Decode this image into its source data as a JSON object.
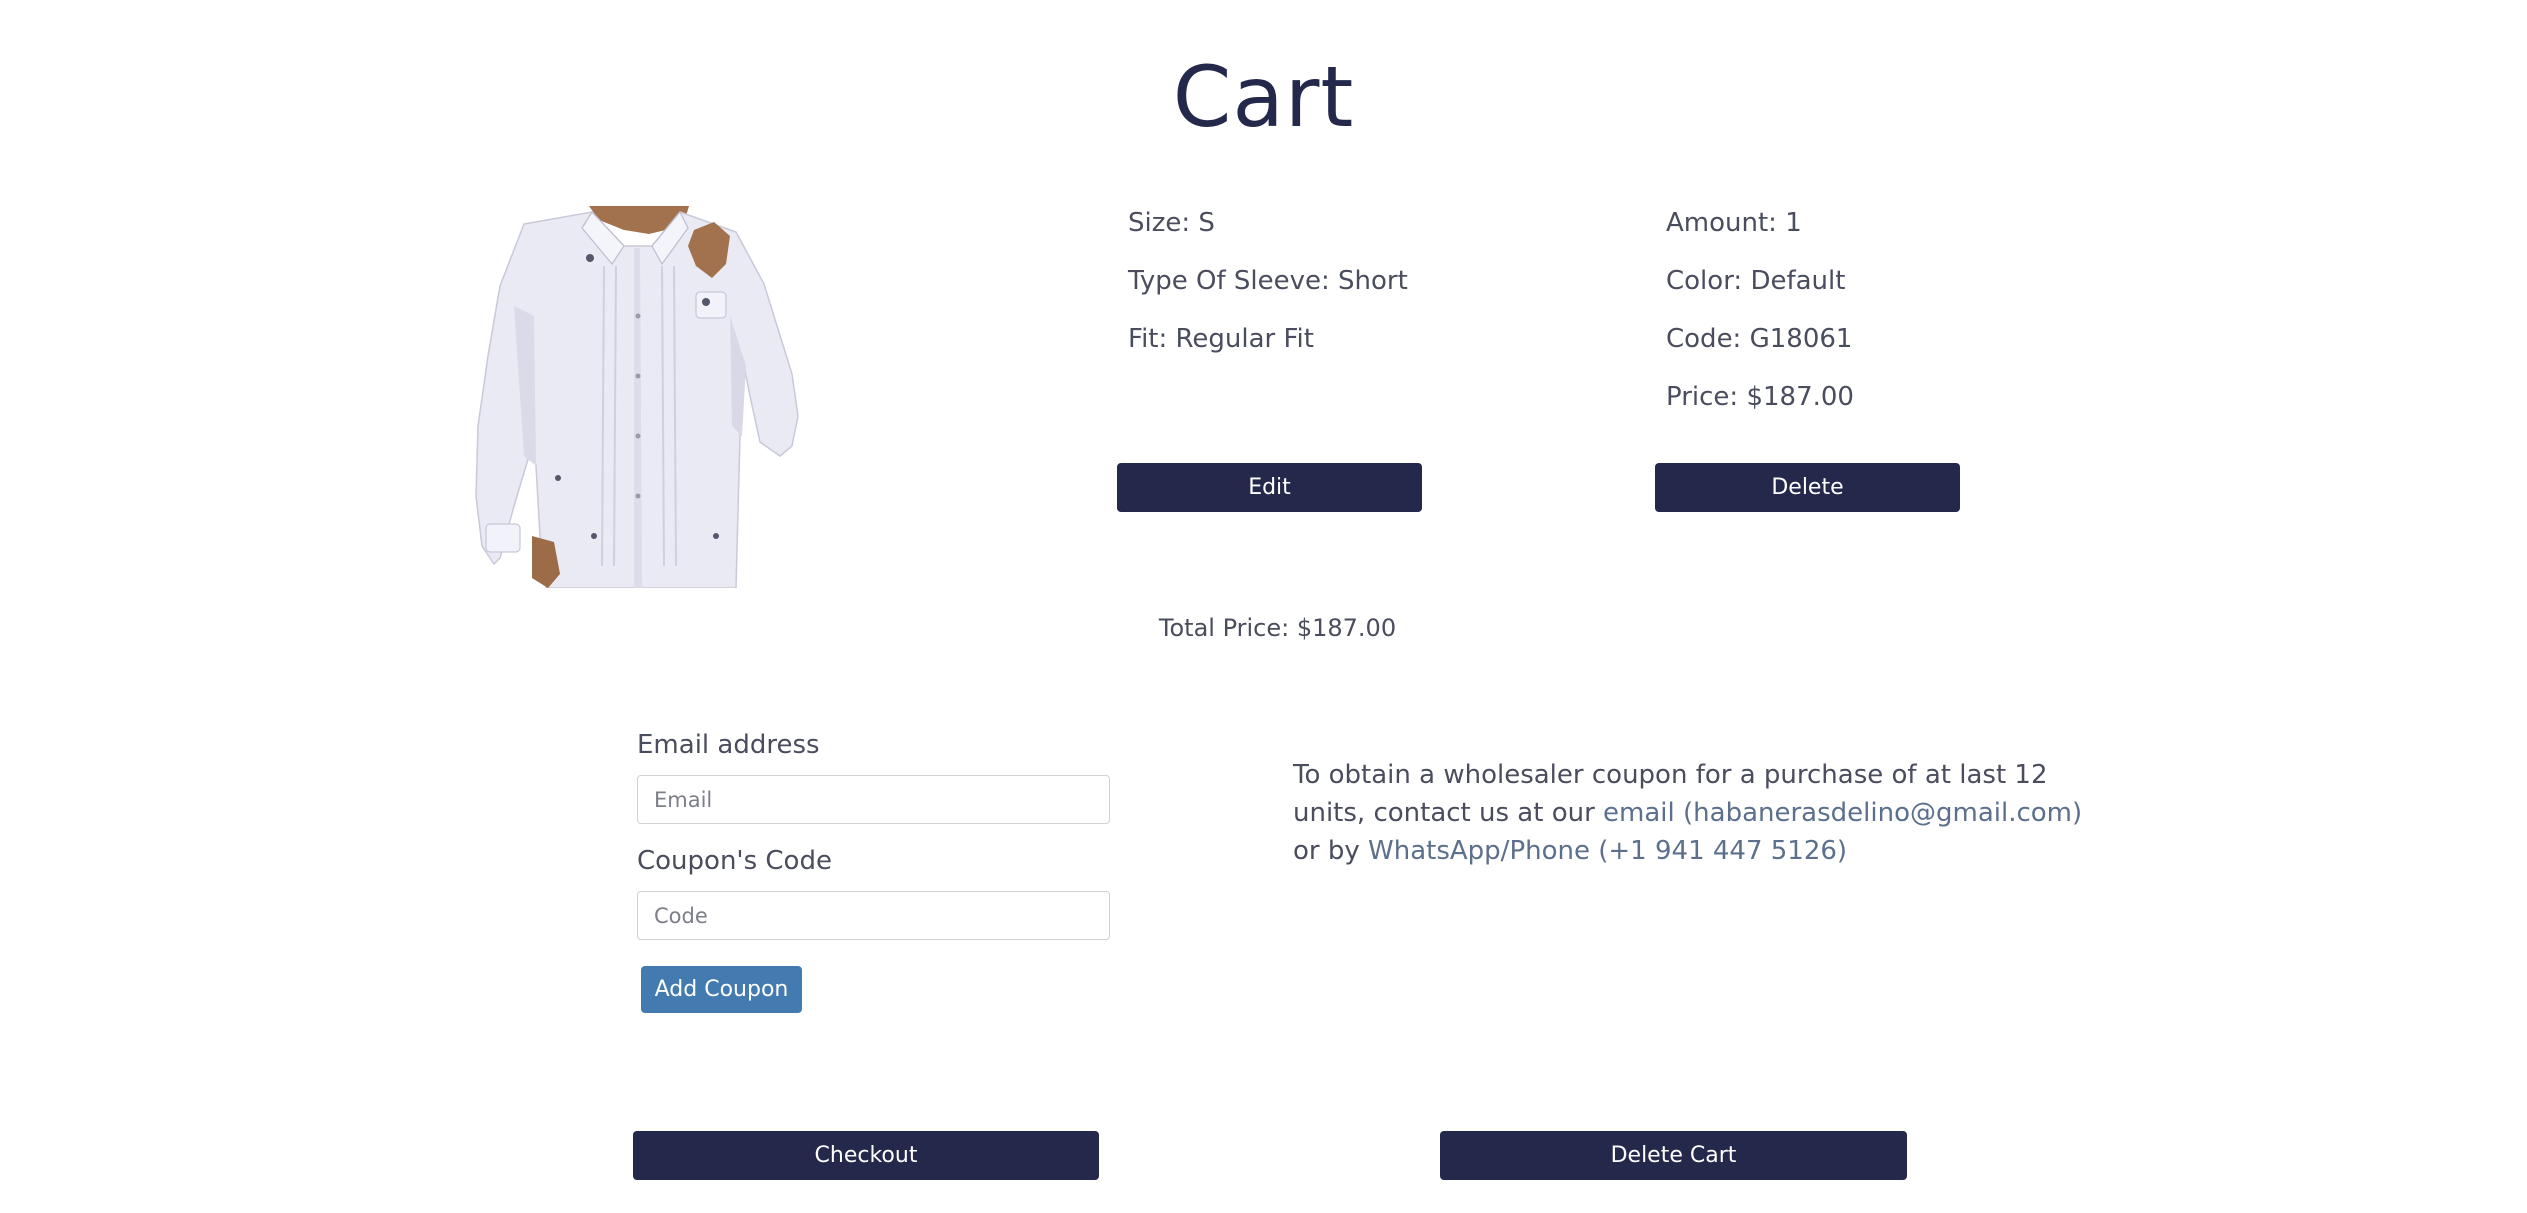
{
  "page": {
    "title": "Cart"
  },
  "colors": {
    "title": "#24294c",
    "dark_button": "#24284b",
    "coupon_button": "#437bb0",
    "text": "#4a4d5e",
    "link": "#5c6f8c"
  },
  "cart_item": {
    "image_icon": "white-guayabera-shirt",
    "size": "Size: S",
    "sleeve": "Type Of Sleeve: Short",
    "fit": "Fit: Regular Fit",
    "amount": "Amount: 1",
    "color": "Color: Default",
    "code": "Code: G18061",
    "price": "Price: $187.00",
    "edit_label": "Edit",
    "delete_label": "Delete"
  },
  "total": {
    "label": "Total Price: $187.00"
  },
  "coupon_form": {
    "email_label": "Email address",
    "email_placeholder": "Email",
    "code_label": "Coupon's Code",
    "code_placeholder": "Code",
    "add_label": "Add Coupon"
  },
  "wholesale": {
    "text_1": "To obtain a wholesaler coupon for a purchase of at last 12 units, contact us at our",
    "email_link": "email (habanerasdelino@gmail.com)",
    "text_2": "or by",
    "phone_link": "WhatsApp/Phone (+1 941 447 5126)"
  },
  "actions": {
    "checkout_label": "Checkout",
    "delete_cart_label": "Delete Cart"
  }
}
